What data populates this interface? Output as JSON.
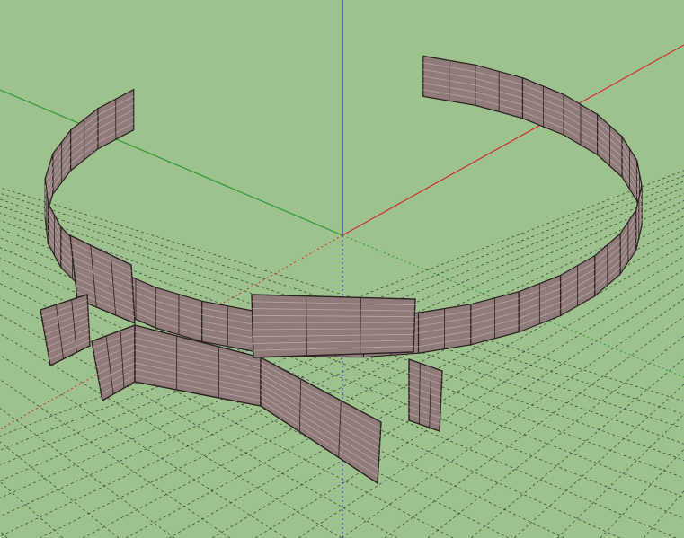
{
  "viewport": {
    "background": "#9dc28e",
    "view": "perspective",
    "axes": {
      "red": "#d1302a",
      "green": "#2e9a2e",
      "blue": "#2f34c8"
    },
    "grid_color": "#111111",
    "wall_face_color": "#8f7b78",
    "wall_line_color": "#2a2022",
    "wall_stripe_color": "#b8a7a3"
  },
  "model": {
    "object": "circular-panel-wall",
    "ring_segment_count": 28,
    "detached_panel_count": 7
  }
}
